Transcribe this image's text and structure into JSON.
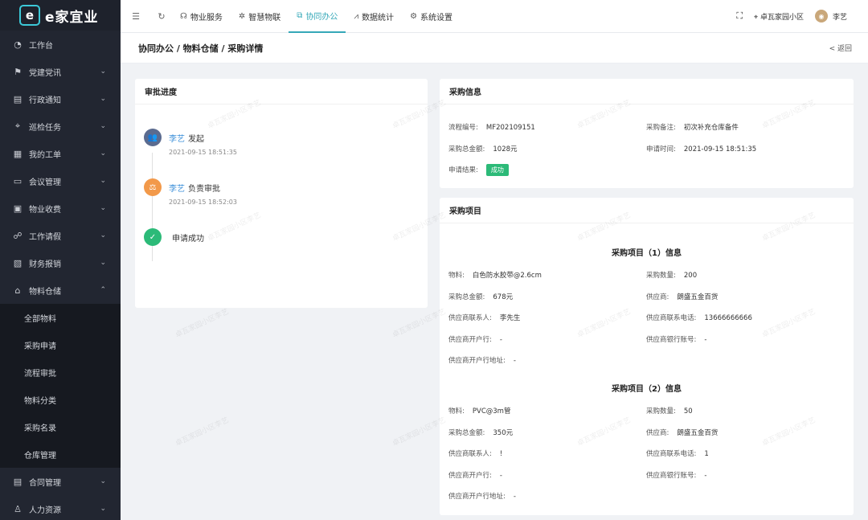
{
  "brand": {
    "mark": "e",
    "name": "e家宜业"
  },
  "sidebar": {
    "items": [
      {
        "label": "工作台",
        "icon": "dashboard-icon",
        "glyph": "◔",
        "chevron": ""
      },
      {
        "label": "党建党讯",
        "icon": "flag-icon",
        "glyph": "⚑",
        "chevron": "⌄"
      },
      {
        "label": "行政通知",
        "icon": "notice-icon",
        "glyph": "▤",
        "chevron": "⌄"
      },
      {
        "label": "巡检任务",
        "icon": "location-icon",
        "glyph": "⌖",
        "chevron": "⌄"
      },
      {
        "label": "我的工单",
        "icon": "order-icon",
        "glyph": "▦",
        "chevron": "⌄"
      },
      {
        "label": "会议管理",
        "icon": "meeting-icon",
        "glyph": "▭",
        "chevron": "⌄"
      },
      {
        "label": "物业收费",
        "icon": "wallet-icon",
        "glyph": "▣",
        "chevron": "⌄"
      },
      {
        "label": "工作请假",
        "icon": "leave-icon",
        "glyph": "☍",
        "chevron": "⌄"
      },
      {
        "label": "财务报销",
        "icon": "finance-icon",
        "glyph": "▧",
        "chevron": "⌄"
      },
      {
        "label": "物料仓储",
        "icon": "warehouse-icon",
        "glyph": "⌂",
        "chevron": "⌃"
      }
    ],
    "submenu": [
      "全部物料",
      "采购申请",
      "流程审批",
      "物料分类",
      "采购名录",
      "仓库管理"
    ],
    "items_after": [
      {
        "label": "合同管理",
        "icon": "contract-icon",
        "glyph": "▤",
        "chevron": "⌄"
      },
      {
        "label": "人力资源",
        "icon": "user-icon",
        "glyph": "♙",
        "chevron": "⌄"
      }
    ]
  },
  "topbar": {
    "tabs": [
      {
        "label": "物业服务",
        "icon": "headset-icon",
        "glyph": "☊"
      },
      {
        "label": "智慧物联",
        "icon": "iot-icon",
        "glyph": "✲"
      },
      {
        "label": "协同办公",
        "icon": "office-icon",
        "glyph": "⧉"
      },
      {
        "label": "数据统计",
        "icon": "chart-icon",
        "glyph": "⩘"
      },
      {
        "label": "系统设置",
        "icon": "gear-icon",
        "glyph": "⚙"
      }
    ],
    "community": "卓瓦家园小区",
    "user": "李艺"
  },
  "page": {
    "breadcrumb": "协同办公 / 物料仓储 / 采购详情",
    "back": "< 返回"
  },
  "approval": {
    "title": "审批进度",
    "steps": [
      {
        "who": "李艺",
        "action": "发起",
        "time": "2021-09-15 18:51:35",
        "color": "#5b6b8f",
        "glyph": "👥"
      },
      {
        "who": "李艺",
        "action": "负责审批",
        "time": "2021-09-15 18:52:03",
        "color": "#f2994a",
        "glyph": "⚖"
      },
      {
        "who": "",
        "action": "申请成功",
        "time": "",
        "color": "#2cba78",
        "glyph": "✓"
      }
    ]
  },
  "purchase_info": {
    "title": "采购信息",
    "process_no_label": "流程编号:",
    "process_no": "MF202109151",
    "remark_label": "采购备注:",
    "remark": "初次补充仓库备件",
    "total_label": "采购总金额:",
    "total": "1028元",
    "apply_time_label": "申请时间:",
    "apply_time": "2021-09-15 18:51:35",
    "result_label": "申请结果:",
    "result": "成功"
  },
  "purchase_items": {
    "title": "采购项目",
    "items": [
      {
        "heading": "采购项目（1）信息",
        "material_label": "物料:",
        "material": "白色防水胶带@2.6cm",
        "qty_label": "采购数量:",
        "qty": "200",
        "amount_label": "采购总金额:",
        "amount": "678元",
        "supplier_label": "供应商:",
        "supplier": "朗盛五金百货",
        "contact_label": "供应商联系人:",
        "contact": "李先生",
        "phone_label": "供应商联系电话:",
        "phone": "13666666666",
        "bank_label": "供应商开户行:",
        "bank": "-",
        "account_label": "供应商银行账号:",
        "account": "-",
        "bank_addr_label": "供应商开户行地址:",
        "bank_addr": "-"
      },
      {
        "heading": "采购项目（2）信息",
        "material_label": "物料:",
        "material": "PVC@3m管",
        "qty_label": "采购数量:",
        "qty": "50",
        "amount_label": "采购总金额:",
        "amount": "350元",
        "supplier_label": "供应商:",
        "supplier": "朗盛五金百货",
        "contact_label": "供应商联系人:",
        "contact": "!",
        "phone_label": "供应商联系电话:",
        "phone": "1",
        "bank_label": "供应商开户行:",
        "bank": "-",
        "account_label": "供应商银行账号:",
        "account": "-",
        "bank_addr_label": "供应商开户行地址:",
        "bank_addr": "-"
      }
    ]
  },
  "watermark": "卓瓦家园小区李艺"
}
